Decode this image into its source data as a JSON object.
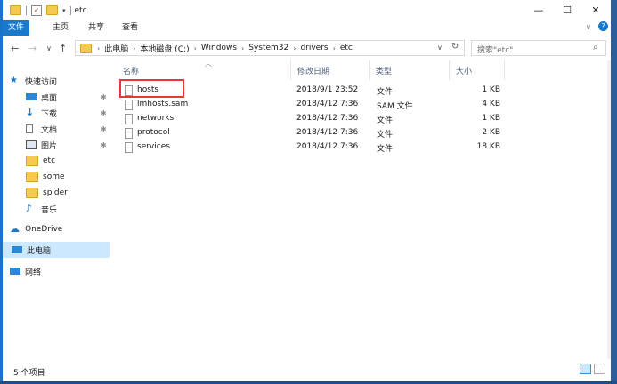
{
  "window": {
    "title": "etc"
  },
  "ribbon": {
    "tabs": [
      "文件",
      "主页",
      "共享",
      "查看"
    ]
  },
  "address": {
    "crumbs": [
      "此电脑",
      "本地磁盘 (C:)",
      "Windows",
      "System32",
      "drivers",
      "etc"
    ]
  },
  "search": {
    "placeholder": "搜索\"etc\""
  },
  "nav": {
    "quick_access": "快速访问",
    "items": [
      "桌面",
      "下载",
      "文档",
      "图片",
      "etc",
      "some",
      "spider",
      "音乐",
      "OneDrive",
      "此电脑",
      "网络"
    ],
    "pin_glyph": "✱"
  },
  "columns": [
    "名称",
    "修改日期",
    "类型",
    "大小"
  ],
  "files": [
    {
      "name": "hosts",
      "date": "2018/9/1 23:52",
      "type": "文件",
      "size": "1 KB"
    },
    {
      "name": "lmhosts.sam",
      "date": "2018/4/12 7:36",
      "type": "SAM 文件",
      "size": "4 KB"
    },
    {
      "name": "networks",
      "date": "2018/4/12 7:36",
      "type": "文件",
      "size": "1 KB"
    },
    {
      "name": "protocol",
      "date": "2018/4/12 7:36",
      "type": "文件",
      "size": "2 KB"
    },
    {
      "name": "services",
      "date": "2018/4/12 7:36",
      "type": "文件",
      "size": "18 KB"
    }
  ],
  "status": {
    "count": "5 个项目"
  },
  "colors": {
    "accent": "#1979ca",
    "selection": "#cce8ff",
    "highlight_box": "#e53935"
  }
}
